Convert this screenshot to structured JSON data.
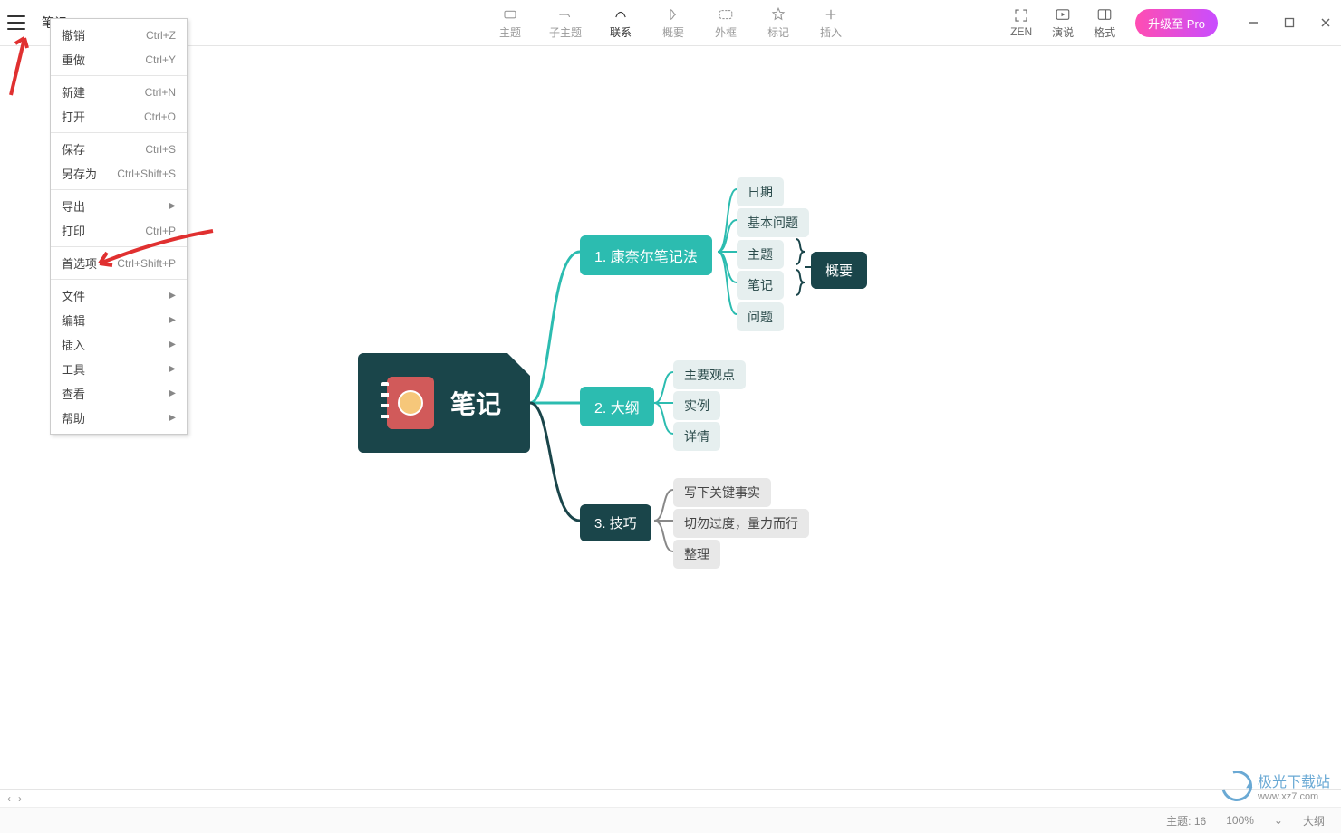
{
  "document": {
    "title": "笔记"
  },
  "toolbar": {
    "topic": "主题",
    "subtopic": "子主题",
    "relationship": "联系",
    "summary_btn": "概要",
    "boundary": "外框",
    "marker": "标记",
    "insert": "插入",
    "zen": "ZEN",
    "presentation": "演说",
    "format": "格式",
    "upgrade": "升级至 Pro"
  },
  "menu": {
    "undo": {
      "label": "撤销",
      "shortcut": "Ctrl+Z"
    },
    "redo": {
      "label": "重做",
      "shortcut": "Ctrl+Y"
    },
    "new": {
      "label": "新建",
      "shortcut": "Ctrl+N"
    },
    "open": {
      "label": "打开",
      "shortcut": "Ctrl+O"
    },
    "save": {
      "label": "保存",
      "shortcut": "Ctrl+S"
    },
    "saveas": {
      "label": "另存为",
      "shortcut": "Ctrl+Shift+S"
    },
    "export": {
      "label": "导出"
    },
    "print": {
      "label": "打印",
      "shortcut": "Ctrl+P"
    },
    "prefs": {
      "label": "首选项",
      "shortcut": "Ctrl+Shift+P"
    },
    "file": {
      "label": "文件"
    },
    "edit": {
      "label": "编辑"
    },
    "insert": {
      "label": "插入"
    },
    "tools": {
      "label": "工具"
    },
    "view": {
      "label": "查看"
    },
    "help": {
      "label": "帮助"
    }
  },
  "mindmap": {
    "root": "笔记",
    "b1": {
      "label": "1. 康奈尔笔记法",
      "children": [
        "日期",
        "基本问题",
        "主题",
        "笔记",
        "问题"
      ]
    },
    "b2": {
      "label": "2. 大纲",
      "children": [
        "主要观点",
        "实例",
        "详情"
      ]
    },
    "b3": {
      "label": "3. 技巧",
      "children": [
        "写下关键事实",
        "切勿过度，量力而行",
        "整理"
      ]
    },
    "summary": "概要"
  },
  "status": {
    "topics_label": "主题:",
    "topics_count": "16",
    "zoom": "100%",
    "outline": "大纲"
  },
  "watermark": {
    "text": "极光下载站",
    "url": "www.xz7.com"
  }
}
